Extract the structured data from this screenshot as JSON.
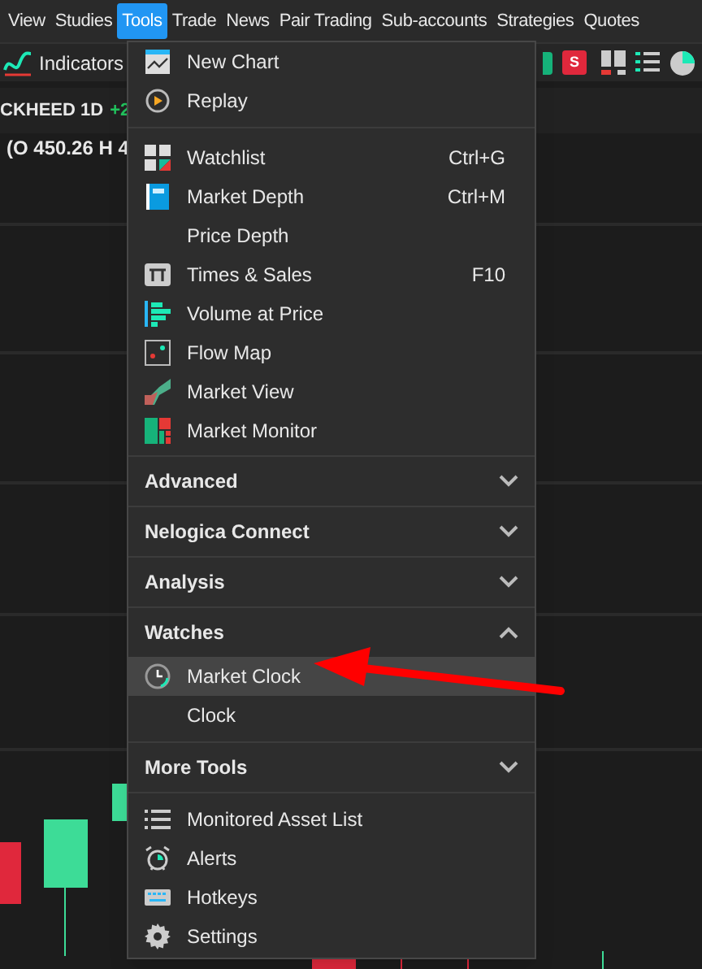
{
  "menu_bar": [
    {
      "label": "View",
      "selected": false
    },
    {
      "label": "Studies",
      "selected": false
    },
    {
      "label": "Tools",
      "selected": true
    },
    {
      "label": "Trade",
      "selected": false
    },
    {
      "label": "News",
      "selected": false
    },
    {
      "label": "Pair Trading",
      "selected": false
    },
    {
      "label": "Sub-accounts",
      "selected": false
    },
    {
      "label": "Strategies",
      "selected": false
    },
    {
      "label": "Quotes",
      "selected": false
    }
  ],
  "toolbar": {
    "indicators_label": "Indicators",
    "s_button": "S"
  },
  "chart_header": {
    "symbol": "CKHEED 1D",
    "change": "+2",
    "ohlc": "(O 450.26 H 4"
  },
  "tools_menu": {
    "items": [
      {
        "label": "New Chart",
        "selected": false
      },
      {
        "label": "Replay",
        "selected": false
      },
      {
        "label": "Watchlist",
        "shortcut": "Ctrl+G",
        "selected": false
      },
      {
        "label": "Market Depth",
        "shortcut": "Ctrl+M",
        "selected": false
      },
      {
        "label": "Price Depth",
        "selected": false
      },
      {
        "label": "Times & Sales",
        "shortcut": "F10",
        "selected": false
      },
      {
        "label": "Volume at Price",
        "selected": false
      },
      {
        "label": "Flow Map",
        "selected": false
      },
      {
        "label": "Market View",
        "selected": false
      },
      {
        "label": "Market Monitor",
        "selected": false
      }
    ],
    "sections": [
      {
        "title": "Advanced",
        "expanded": false
      },
      {
        "title": "Nelogica Connect",
        "expanded": false
      },
      {
        "title": "Analysis",
        "expanded": false
      },
      {
        "title": "Watches",
        "expanded": true,
        "items": [
          {
            "label": "Market Clock",
            "selected": true
          },
          {
            "label": "Clock",
            "selected": false
          }
        ]
      },
      {
        "title": "More Tools",
        "expanded": false
      }
    ],
    "footer_items": [
      {
        "label": "Monitored Asset List",
        "selected": false
      },
      {
        "label": "Alerts",
        "selected": false
      },
      {
        "label": "Hotkeys",
        "selected": false
      },
      {
        "label": "Settings",
        "selected": false
      }
    ]
  }
}
